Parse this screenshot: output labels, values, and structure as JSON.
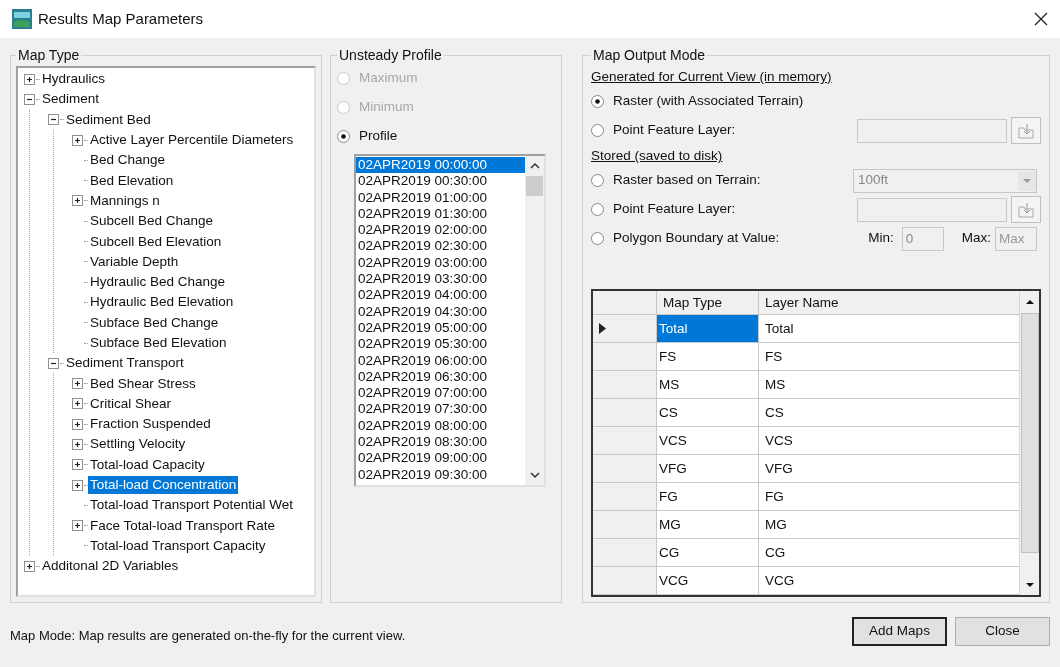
{
  "window": {
    "title": "Results Map Parameters"
  },
  "map_type": {
    "title": "Map Type",
    "tree": [
      {
        "label": "Hydraulics",
        "kind": "folder",
        "expanded": false,
        "selected": false
      },
      {
        "label": "Sediment",
        "kind": "folder",
        "expanded": true,
        "selected": false,
        "children": [
          {
            "label": "Sediment Bed",
            "kind": "folder",
            "expanded": true,
            "selected": false,
            "children": [
              {
                "label": "Active Layer Percentile Diameters",
                "kind": "folder",
                "expanded": false,
                "selected": false
              },
              {
                "label": "Bed Change",
                "kind": "leaf",
                "selected": false
              },
              {
                "label": "Bed Elevation",
                "kind": "leaf",
                "selected": false
              },
              {
                "label": "Mannings n",
                "kind": "folder",
                "expanded": false,
                "selected": false
              },
              {
                "label": "Subcell Bed Change",
                "kind": "leaf",
                "selected": false
              },
              {
                "label": "Subcell Bed Elevation",
                "kind": "leaf",
                "selected": false
              },
              {
                "label": "Variable Depth",
                "kind": "leaf",
                "selected": false
              },
              {
                "label": "Hydraulic Bed Change",
                "kind": "leaf",
                "selected": false
              },
              {
                "label": "Hydraulic Bed Elevation",
                "kind": "leaf",
                "selected": false
              },
              {
                "label": "Subface Bed Change",
                "kind": "leaf",
                "selected": false
              },
              {
                "label": "Subface Bed Elevation",
                "kind": "leaf",
                "selected": false
              }
            ]
          },
          {
            "label": "Sediment Transport",
            "kind": "folder",
            "expanded": true,
            "selected": false,
            "children": [
              {
                "label": "Bed Shear Stress",
                "kind": "folder",
                "expanded": false,
                "selected": false
              },
              {
                "label": "Critical Shear",
                "kind": "folder",
                "expanded": false,
                "selected": false
              },
              {
                "label": "Fraction Suspended",
                "kind": "folder",
                "expanded": false,
                "selected": false
              },
              {
                "label": "Settling Velocity",
                "kind": "folder",
                "expanded": false,
                "selected": false
              },
              {
                "label": "Total-load Capacity",
                "kind": "folder",
                "expanded": false,
                "selected": false
              },
              {
                "label": "Total-load Concentration",
                "kind": "folder",
                "expanded": false,
                "selected": true
              },
              {
                "label": "Total-load Transport Potential Wet",
                "kind": "leaf",
                "selected": false
              },
              {
                "label": "Face Total-load Transport Rate",
                "kind": "folder",
                "expanded": false,
                "selected": false
              },
              {
                "label": "Total-load Transport Capacity",
                "kind": "leaf",
                "selected": false
              }
            ]
          }
        ]
      },
      {
        "label": "Additonal 2D Variables",
        "kind": "folder",
        "expanded": false,
        "selected": false
      }
    ]
  },
  "unsteady_profile": {
    "title": "Unsteady Profile",
    "options": [
      {
        "label": "Maximum",
        "selected": false,
        "disabled": true
      },
      {
        "label": "Minimum",
        "selected": false,
        "disabled": true
      },
      {
        "label": "Profile",
        "selected": true,
        "disabled": false
      }
    ],
    "profiles": [
      {
        "label": "02APR2019 00:00:00",
        "selected": true
      },
      {
        "label": "02APR2019 00:30:00",
        "selected": false
      },
      {
        "label": "02APR2019 01:00:00",
        "selected": false
      },
      {
        "label": "02APR2019 01:30:00",
        "selected": false
      },
      {
        "label": "02APR2019 02:00:00",
        "selected": false
      },
      {
        "label": "02APR2019 02:30:00",
        "selected": false
      },
      {
        "label": "02APR2019 03:00:00",
        "selected": false
      },
      {
        "label": "02APR2019 03:30:00",
        "selected": false
      },
      {
        "label": "02APR2019 04:00:00",
        "selected": false
      },
      {
        "label": "02APR2019 04:30:00",
        "selected": false
      },
      {
        "label": "02APR2019 05:00:00",
        "selected": false
      },
      {
        "label": "02APR2019 05:30:00",
        "selected": false
      },
      {
        "label": "02APR2019 06:00:00",
        "selected": false
      },
      {
        "label": "02APR2019 06:30:00",
        "selected": false
      },
      {
        "label": "02APR2019 07:00:00",
        "selected": false
      },
      {
        "label": "02APR2019 07:30:00",
        "selected": false
      },
      {
        "label": "02APR2019 08:00:00",
        "selected": false
      },
      {
        "label": "02APR2019 08:30:00",
        "selected": false
      },
      {
        "label": "02APR2019 09:00:00",
        "selected": false
      },
      {
        "label": "02APR2019 09:30:00",
        "selected": false
      }
    ]
  },
  "map_output_mode": {
    "title": "Map Output Mode",
    "sections": [
      {
        "heading": "Generated for Current View (in memory)",
        "options": [
          {
            "label": "Raster (with Associated Terrain)",
            "selected": true,
            "kind": "plain"
          },
          {
            "label": "Point Feature Layer:",
            "selected": false,
            "kind": "layer_picker"
          }
        ]
      },
      {
        "heading": "Stored (saved to disk)",
        "options": [
          {
            "label": "Raster based on Terrain:",
            "selected": false,
            "kind": "dropdown",
            "value": "100ft"
          },
          {
            "label": "Point Feature Layer:",
            "selected": false,
            "kind": "layer_picker"
          },
          {
            "label": "Polygon Boundary at Value:",
            "selected": false,
            "kind": "range",
            "min_label": "Min:",
            "min_value": "0",
            "max_label": "Max:",
            "max_placeholder": "Max"
          }
        ]
      }
    ],
    "table": {
      "columns": [
        "Map Type",
        "Layer Name"
      ],
      "rows": [
        {
          "map_type": "Total",
          "layer_name": "Total",
          "selected": true
        },
        {
          "map_type": "FS",
          "layer_name": "FS",
          "selected": false
        },
        {
          "map_type": "MS",
          "layer_name": "MS",
          "selected": false
        },
        {
          "map_type": "CS",
          "layer_name": "CS",
          "selected": false
        },
        {
          "map_type": "VCS",
          "layer_name": "VCS",
          "selected": false
        },
        {
          "map_type": "VFG",
          "layer_name": "VFG",
          "selected": false
        },
        {
          "map_type": "FG",
          "layer_name": "FG",
          "selected": false
        },
        {
          "map_type": "MG",
          "layer_name": "MG",
          "selected": false
        },
        {
          "map_type": "CG",
          "layer_name": "CG",
          "selected": false
        },
        {
          "map_type": "VCG",
          "layer_name": "VCG",
          "selected": false
        }
      ]
    }
  },
  "status_bar": "Map Mode: Map results are generated on-the-fly for the current view.",
  "buttons": [
    {
      "label": "Add Maps",
      "default": true
    },
    {
      "label": "Close",
      "default": false
    }
  ]
}
